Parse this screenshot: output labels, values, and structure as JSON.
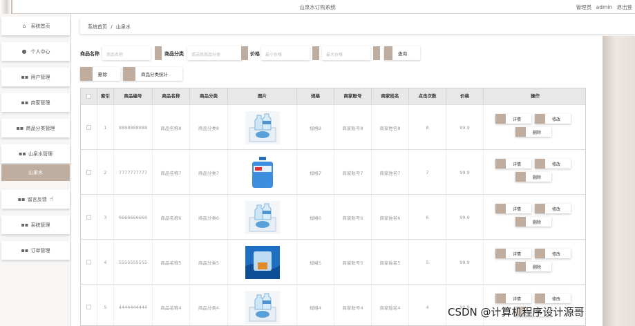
{
  "app": {
    "title": "山泉水订购系统"
  },
  "user": {
    "role": "管理员",
    "name": "admin",
    "logout": "退出登"
  },
  "sidebar": {
    "items": [
      {
        "label": "系统首页",
        "icon": "home-icon"
      },
      {
        "label": "个人中心",
        "icon": "person-icon"
      },
      {
        "label": "用户管理",
        "icon": "grid-icon"
      },
      {
        "label": "商家管理",
        "icon": "grid-icon"
      },
      {
        "label": "商品分类管理",
        "icon": "grid-icon"
      },
      {
        "label": "山泉水管理",
        "icon": "grid-icon"
      },
      {
        "label": "山泉水",
        "icon": "",
        "active": true
      },
      {
        "label": "留言反馈",
        "icon": "grid-icon"
      },
      {
        "label": "系统管理",
        "icon": "grid-icon"
      },
      {
        "label": "订单管理",
        "icon": "grid-icon"
      }
    ]
  },
  "breadcrumb": {
    "home": "系统首页",
    "separator": "/",
    "current": "山泉水"
  },
  "search": {
    "name_label": "商品名称",
    "name_placeholder": "商品名称",
    "category_label": "商品分类",
    "category_placeholder": "请选择商品分类",
    "price_label": "价格",
    "min_placeholder": "最小价格",
    "max_placeholder": "最大价格",
    "query_button": "查询"
  },
  "actions": {
    "delete": "删除",
    "stats": "商品分类统计"
  },
  "table": {
    "headers": [
      "索引",
      "商品编号",
      "商品名称",
      "商品分类",
      "图片",
      "规格",
      "商家账号",
      "商家姓名",
      "点击次数",
      "价格",
      "操作"
    ],
    "rows": [
      {
        "index": "1",
        "code": "8888888888",
        "name": "商品名称8",
        "category": "商品分类8",
        "spec": "规格8",
        "account": "商家账号8",
        "merchant": "商家姓名8",
        "clicks": "8",
        "price": "99.9",
        "image": "bottles-pack"
      },
      {
        "index": "2",
        "code": "7777777777",
        "name": "商品名称7",
        "category": "商品分类7",
        "spec": "规格7",
        "account": "商家账号7",
        "merchant": "商家姓名7",
        "clicks": "7",
        "price": "99.9",
        "image": "water-jug"
      },
      {
        "index": "3",
        "code": "6666666666",
        "name": "商品名称6",
        "category": "商品分类6",
        "spec": "规格6",
        "account": "商家账号6",
        "merchant": "商家姓名6",
        "clicks": "6",
        "price": "99.9",
        "image": "bottles-pack"
      },
      {
        "index": "4",
        "code": "5555555555",
        "name": "商品名称5",
        "category": "商品分类5",
        "spec": "规格5",
        "account": "商家账号5",
        "merchant": "商家姓名5",
        "clicks": "5",
        "price": "99.9",
        "image": "dispenser-jug"
      },
      {
        "index": "5",
        "code": "4444444444",
        "name": "商品名称4",
        "category": "商品分类4",
        "spec": "规格4",
        "account": "商家账号4",
        "merchant": "商家姓名4",
        "clicks": "4",
        "price": "99.9",
        "image": "bottles-pack"
      }
    ],
    "ops": {
      "detail": "详情",
      "edit": "修改",
      "delete": "删除"
    }
  },
  "watermark": "CSDN @计算机程序设计源哥",
  "colors": {
    "accent": "#bfae9f",
    "header_bg": "#e8e8e8"
  }
}
